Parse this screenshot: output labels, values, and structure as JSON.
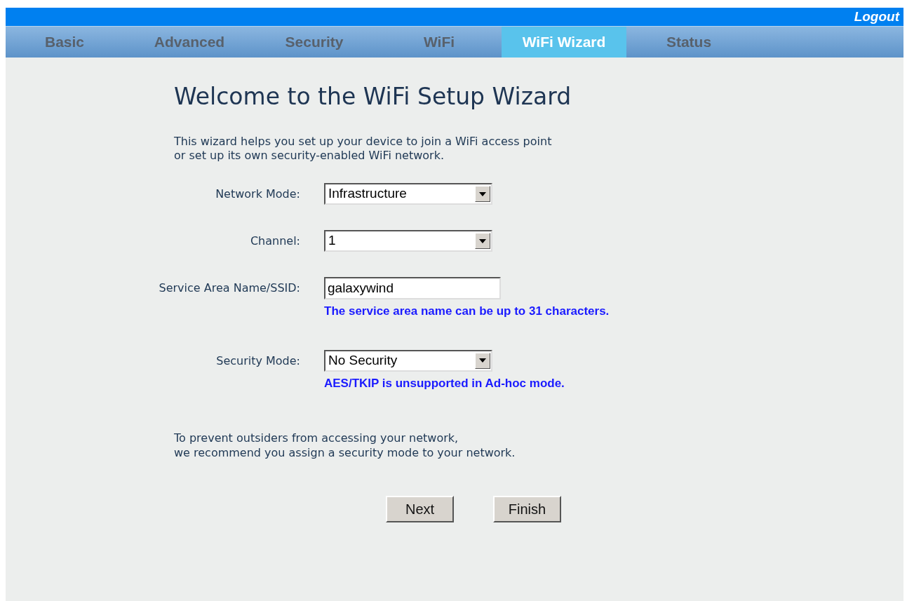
{
  "top_bar": {
    "logout": "Logout"
  },
  "tabs": [
    {
      "label": "Basic",
      "selected": false
    },
    {
      "label": "Advanced",
      "selected": false
    },
    {
      "label": "Security",
      "selected": false
    },
    {
      "label": "WiFi",
      "selected": false
    },
    {
      "label": "WiFi Wizard",
      "selected": true
    },
    {
      "label": "Status",
      "selected": false
    }
  ],
  "heading": "Welcome to the WiFi Setup Wizard",
  "intro": [
    "This wizard helps you set up your device to join a WiFi access point",
    "or set up its own security-enabled WiFi network."
  ],
  "fields": [
    {
      "kind": "select",
      "label": "Network Mode:",
      "value": "Infrastructure"
    },
    {
      "kind": "select",
      "label": "Channel:",
      "value": "1"
    },
    {
      "kind": "text",
      "label": "Service Area Name/SSID:",
      "value": "galaxywind",
      "hint": "The service area name can be up to 31 characters."
    },
    {
      "kind": "select",
      "label": "Security Mode:",
      "value": "No Security",
      "hint": "AES/TKIP is unsupported in Ad-hoc mode."
    }
  ],
  "note": [
    "To prevent outsiders from accessing your network,",
    "we recommend you assign a security mode to your network."
  ],
  "buttons": [
    "Next",
    "Finish"
  ]
}
